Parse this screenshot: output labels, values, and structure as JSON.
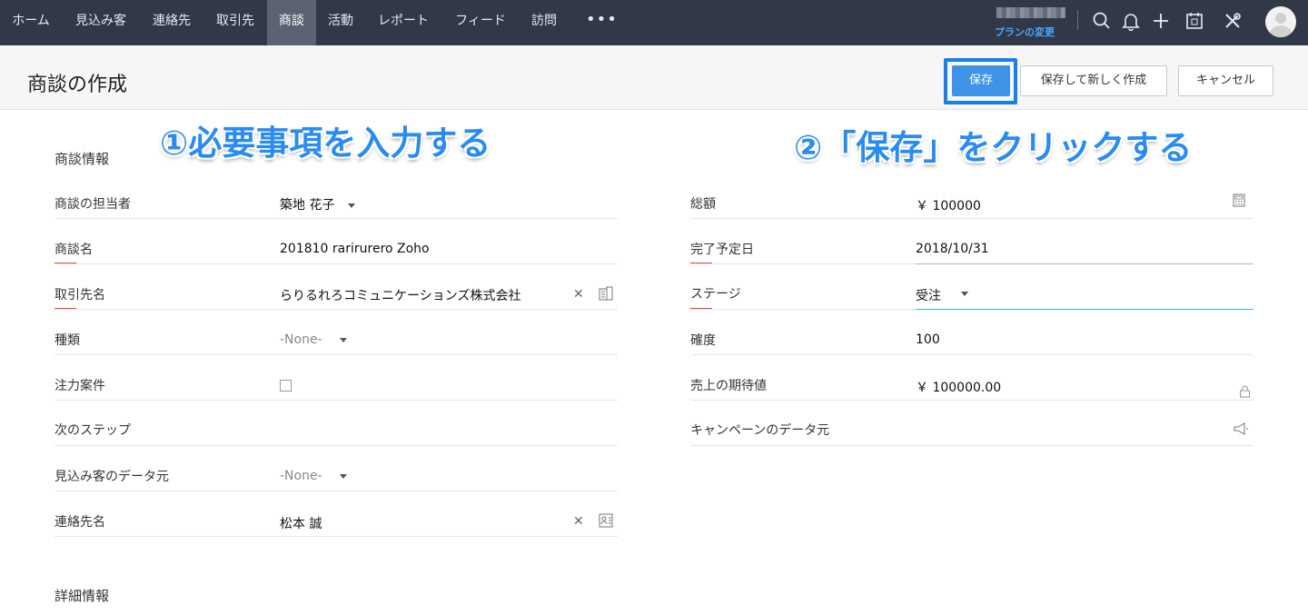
{
  "nav": {
    "items": [
      "ホーム",
      "見込み客",
      "連絡先",
      "取引先",
      "商談",
      "活動",
      "レポート",
      "フィード",
      "訪問"
    ],
    "active_index": 4,
    "more": "•••",
    "plan_link": "プランの変更"
  },
  "header": {
    "title": "商談の作成",
    "save": "保存",
    "save_new": "保存して新しく作成",
    "cancel": "キャンセル"
  },
  "annotations": {
    "step1": "①必要事項を入力する",
    "step2": "②「保存」をクリックする"
  },
  "form": {
    "section1": "商談情報",
    "section2": "詳細情報",
    "left": [
      {
        "label": "商談の担当者",
        "value": "築地 花子"
      },
      {
        "label": "商談名",
        "value": "201810 rarirurero Zoho"
      },
      {
        "label": "取引先名",
        "value": "らりるれろコミュニケーションズ株式会社"
      },
      {
        "label": "種類",
        "value": "-None-"
      },
      {
        "label": "注力案件",
        "value": ""
      },
      {
        "label": "次のステップ",
        "value": ""
      },
      {
        "label": "見込み客のデータ元",
        "value": "-None-"
      },
      {
        "label": "連絡先名",
        "value": "松本 誠"
      }
    ],
    "right": [
      {
        "label": "総額",
        "value": "￥ 100000"
      },
      {
        "label": "完了予定日",
        "value": "2018/10/31"
      },
      {
        "label": "ステージ",
        "value": "受注"
      },
      {
        "label": "確度",
        "value": "100"
      },
      {
        "label": "売上の期待値",
        "value": "￥ 100000.00"
      },
      {
        "label": "キャンペーンのデータ元",
        "value": ""
      }
    ],
    "clear_glyph": "✕"
  },
  "colors": {
    "nav_bg": "#313949",
    "accent": "#3f93e6",
    "annotation": "#2a8cf0",
    "required": "#e74c3c"
  }
}
